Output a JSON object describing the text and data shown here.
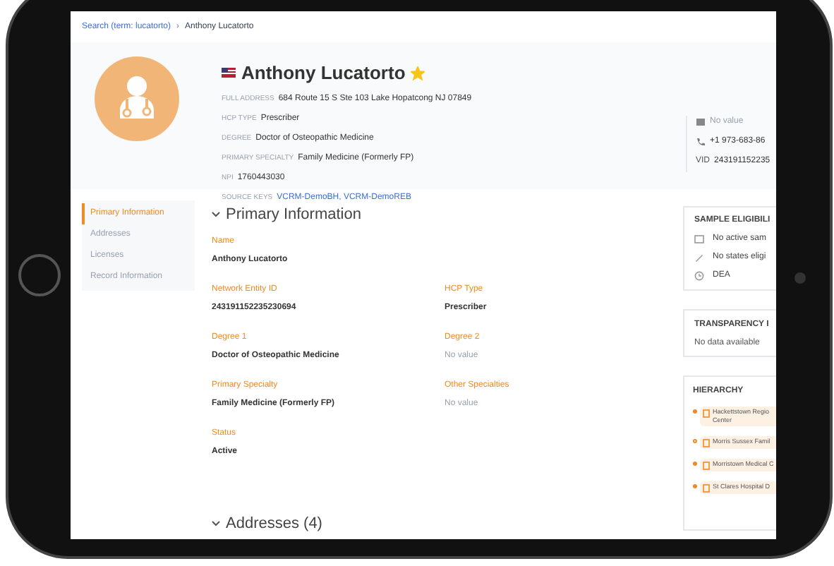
{
  "breadcrumb": {
    "link": "Search (term: lucatorto)",
    "separator": "›",
    "current": "Anthony Lucatorto"
  },
  "profile": {
    "name": "Anthony Lucatorto",
    "favorite": true,
    "fields": [
      {
        "label": "FULL ADDRESS",
        "value": "684 Route 15 S Ste 103 Lake Hopatcong NJ 07849",
        "kind": "text"
      },
      {
        "label": "HCP TYPE",
        "value": "Prescriber",
        "kind": "text"
      },
      {
        "label": "DEGREE",
        "value": "Doctor of Osteopathic Medicine",
        "kind": "text"
      },
      {
        "label": "PRIMARY SPECIALTY",
        "value": "Family Medicine (Formerly FP)",
        "kind": "text"
      },
      {
        "label": "NPI",
        "value": "1760443030",
        "kind": "text"
      },
      {
        "label": "SOURCE KEYS",
        "value": "VCRM-DemoBH, VCRM-DemoREB",
        "kind": "link"
      }
    ],
    "contacts": [
      {
        "kind": "email",
        "value": "No value"
      },
      {
        "kind": "phone",
        "value": "+1 973-683-86"
      },
      {
        "kind": "vid",
        "label": "VID",
        "value": "243191152235"
      }
    ]
  },
  "nav": [
    {
      "label": "Primary Information",
      "selected": true
    },
    {
      "label": "Addresses",
      "selected": false
    },
    {
      "label": "Licenses",
      "selected": false
    },
    {
      "label": "Record Information",
      "selected": false
    }
  ],
  "primary": {
    "title": "Primary Information",
    "fields": [
      {
        "label": "Name",
        "value": "Anthony Lucatorto",
        "empty": false
      },
      {
        "label": "Network Entity ID",
        "value": "243191152235230694",
        "empty": false
      },
      {
        "label": "HCP Type",
        "value": "Prescriber",
        "empty": false
      },
      {
        "label": "Degree 1",
        "value": "Doctor of Osteopathic Medicine",
        "empty": false
      },
      {
        "label": "Degree 2",
        "value": "No value",
        "empty": true
      },
      {
        "label": "Primary Specialty",
        "value": "Family Medicine (Formerly FP)",
        "empty": false
      },
      {
        "label": "Other Specialties",
        "value": "No value",
        "empty": true
      },
      {
        "label": "Status",
        "value": "Active",
        "empty": false
      }
    ]
  },
  "addresses": {
    "title": "Addresses (4)"
  },
  "sample_eligibility": {
    "title": "SAMPLE ELIGIBILI",
    "items": [
      {
        "kind": "card",
        "text": "No active sam"
      },
      {
        "kind": "pen",
        "text": "No states eligi"
      },
      {
        "kind": "clock",
        "text": "DEA"
      }
    ]
  },
  "transparency": {
    "title": "TRANSPARENCY I",
    "text": "No data available"
  },
  "hierarchy": {
    "title": "HIERARCHY",
    "items": [
      {
        "lines": [
          "Hackettstown Regio",
          "Center"
        ],
        "filled": true
      },
      {
        "lines": [
          "Morris Sussex Famil"
        ],
        "filled": false
      },
      {
        "lines": [
          "Morristown Medical C"
        ],
        "filled": true
      },
      {
        "lines": [
          "St Clares Hospital D"
        ],
        "filled": true
      }
    ]
  }
}
